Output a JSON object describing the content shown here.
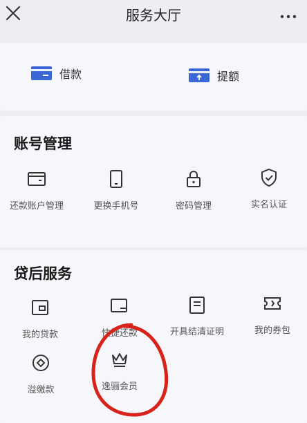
{
  "header": {
    "title": "服务大厅"
  },
  "quick_actions": [
    {
      "label": "借款",
      "icon": "card-icon"
    },
    {
      "label": "提额",
      "icon": "card-up-icon"
    }
  ],
  "account": {
    "title": "账号管理",
    "items": [
      {
        "label": "还款账户管理",
        "icon": "wallet-icon"
      },
      {
        "label": "更换手机号",
        "icon": "phone-icon"
      },
      {
        "label": "密码管理",
        "icon": "lock-icon"
      },
      {
        "label": "实名认证",
        "icon": "shield-check-icon"
      }
    ]
  },
  "loan_service": {
    "title": "贷后服务",
    "items": [
      {
        "label": "我的贷款",
        "icon": "wallet-icon"
      },
      {
        "label": "快捷还款",
        "icon": "card-icon"
      },
      {
        "label": "开具结清证明",
        "icon": "document-icon"
      },
      {
        "label": "我的券包",
        "icon": "ticket-icon"
      },
      {
        "label": "溢缴款",
        "icon": "diamond-coin-icon"
      },
      {
        "label": "逸骊会员",
        "icon": "crown-icon"
      }
    ]
  },
  "colors": {
    "accent": "#3b66d6",
    "annotation": "#d8231a"
  }
}
